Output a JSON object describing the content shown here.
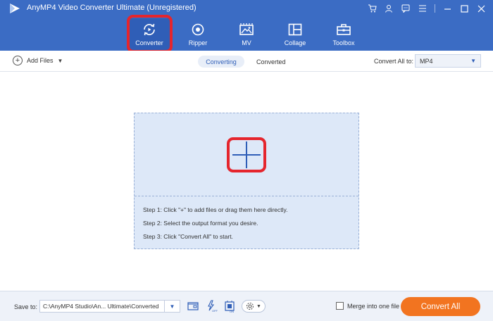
{
  "app": {
    "title": "AnyMP4 Video Converter Ultimate (Unregistered)",
    "logo_icon": "play-logo-icon"
  },
  "window_controls": [
    "cart-icon",
    "user-icon",
    "feedback-icon",
    "menu-icon",
    "minimize-icon",
    "maximize-icon",
    "close-icon"
  ],
  "nav": {
    "items": [
      {
        "label": "Converter",
        "icon": "convert-icon",
        "active": true
      },
      {
        "label": "Ripper",
        "icon": "disc-icon",
        "active": false
      },
      {
        "label": "MV",
        "icon": "image-icon",
        "active": false
      },
      {
        "label": "Collage",
        "icon": "collage-icon",
        "active": false
      },
      {
        "label": "Toolbox",
        "icon": "toolbox-icon",
        "active": false
      }
    ]
  },
  "subbar": {
    "add_files_label": "Add Files",
    "tabs": [
      {
        "label": "Converting",
        "active": true
      },
      {
        "label": "Converted",
        "active": false
      }
    ],
    "convert_all_to_label": "Convert All to:",
    "format_value": "MP4"
  },
  "dropzone": {
    "steps": [
      "Step 1: Click \"+\" to add files or drag them here directly.",
      "Step 2: Select the output format you desire.",
      "Step 3: Click \"Convert All\" to start."
    ]
  },
  "bottombar": {
    "save_to_label": "Save to:",
    "path_value": "C:\\AnyMP4 Studio\\An... Ultimate\\Converted",
    "merge_label": "Merge into one file",
    "merge_checked": false,
    "convert_all_label": "Convert All"
  },
  "colors": {
    "header_blue": "#3b6cc4",
    "active_nav": "#2f5eb7",
    "highlight_red": "#e5252d",
    "dropzone_bg": "#dde8f8",
    "convert_button": "#f27420"
  }
}
